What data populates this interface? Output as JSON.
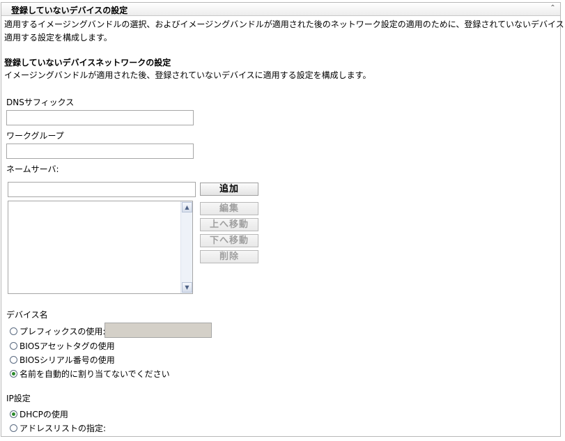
{
  "panel": {
    "title": "登録していないデバイスの設定",
    "description_line1": "適用するイメージングバンドルの選択、およびイメージングバンドルが適用された後のネットワーク設定の適用のために、登録されていないデバイスに",
    "description_line2": "適用する設定を構成します。"
  },
  "network": {
    "heading": "登録していないデバイスネットワークの設定",
    "description": "イメージングバンドルが適用された後、登録されていないデバイスに適用する設定を構成します。",
    "dns_label": "DNSサフィックス",
    "dns_value": "",
    "workgroup_label": "ワークグループ",
    "workgroup_value": "",
    "nameserver_label": "ネームサーバ:",
    "nameserver_value": "",
    "buttons": {
      "add": "追加",
      "edit": "編集",
      "move_up": "上へ移動",
      "move_down": "下へ移動",
      "delete": "削除"
    }
  },
  "device_name": {
    "label": "デバイス名",
    "options": [
      {
        "label": "プレフィックスの使用:",
        "checked": false
      },
      {
        "label": "BIOSアセットタグの使用",
        "checked": false
      },
      {
        "label": "BIOSシリアル番号の使用",
        "checked": false
      },
      {
        "label": "名前を自動的に割り当てないでください",
        "checked": true
      }
    ],
    "prefix_value": ""
  },
  "ip": {
    "label": "IP設定",
    "options": [
      {
        "label": "DHCPの使用",
        "checked": true
      },
      {
        "label": "アドレスリストの指定:",
        "checked": false
      }
    ]
  },
  "icons": {
    "collapse": "double-chevron-up-icon",
    "scroll_up": "scroll-up-arrow-icon",
    "scroll_down": "scroll-down-arrow-icon"
  },
  "colors": {
    "radio_checked": "#2a8a2a",
    "disabled_input": "#d4d0c8",
    "disabled_button_text": "#a0a0a0"
  }
}
